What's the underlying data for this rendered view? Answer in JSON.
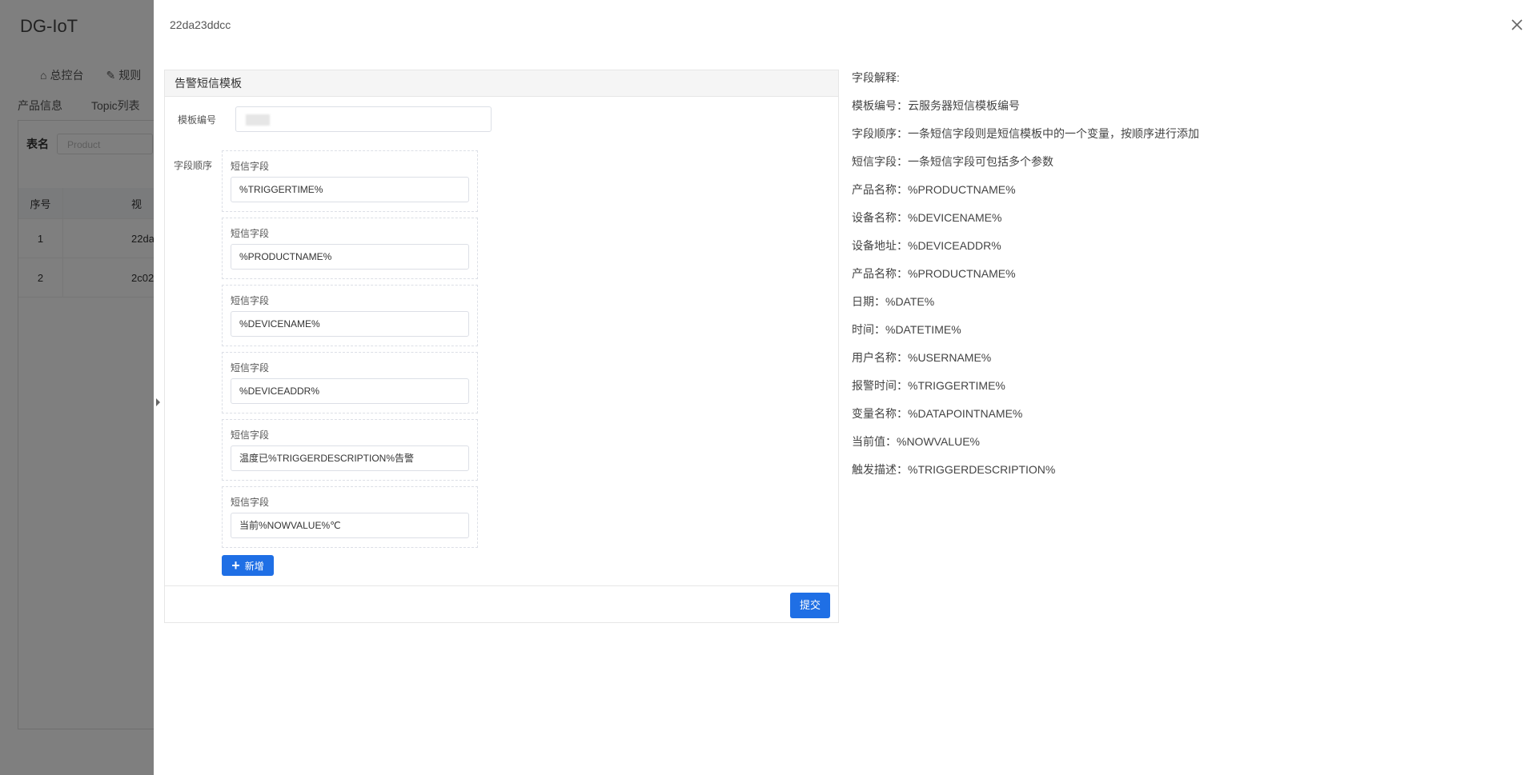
{
  "background": {
    "app_title": "DG-IoT",
    "nav": [
      "总控台",
      "规则"
    ],
    "tabs": [
      "产品信息",
      "Topic列表"
    ],
    "filter_label": "表名",
    "filter_placeholder": "Product",
    "table_headers": [
      "序号",
      "视"
    ],
    "table_rows": [
      {
        "index": "1",
        "value": "22da"
      },
      {
        "index": "2",
        "value": "2c02"
      }
    ]
  },
  "drawer": {
    "title": "22da23ddcc",
    "card_title": "告警短信模板",
    "code_label": "模板编号",
    "order_label": "字段顺序",
    "field_label": "短信字段",
    "fields": [
      "%TRIGGERTIME%",
      "%PRODUCTNAME%",
      "%DEVICENAME%",
      "%DEVICEADDR%",
      "温度已%TRIGGERDESCRIPTION%告警",
      "当前%NOWVALUE%℃"
    ],
    "add_label": "新增",
    "submit_label": "提交"
  },
  "explanation": [
    "字段解释:",
    "模板编号：云服务器短信模板编号",
    "字段顺序：一条短信字段则是短信模板中的一个变量，按顺序进行添加",
    "短信字段：一条短信字段可包括多个参数",
    "产品名称：%PRODUCTNAME%",
    "设备名称：%DEVICENAME%",
    "设备地址：%DEVICEADDR%",
    "产品名称：%PRODUCTNAME%",
    "日期：%DATE%",
    "时间：%DATETIME%",
    "用户名称：%USERNAME%",
    "报警时间：%TRIGGERTIME%",
    "变量名称：%DATAPOINTNAME%",
    "当前值：%NOWVALUE%",
    "触发描述：%TRIGGERDESCRIPTION%"
  ],
  "icons": {
    "close": "close-icon",
    "add": "plus-icon",
    "home": "home-icon",
    "rule": "pencil-icon"
  }
}
